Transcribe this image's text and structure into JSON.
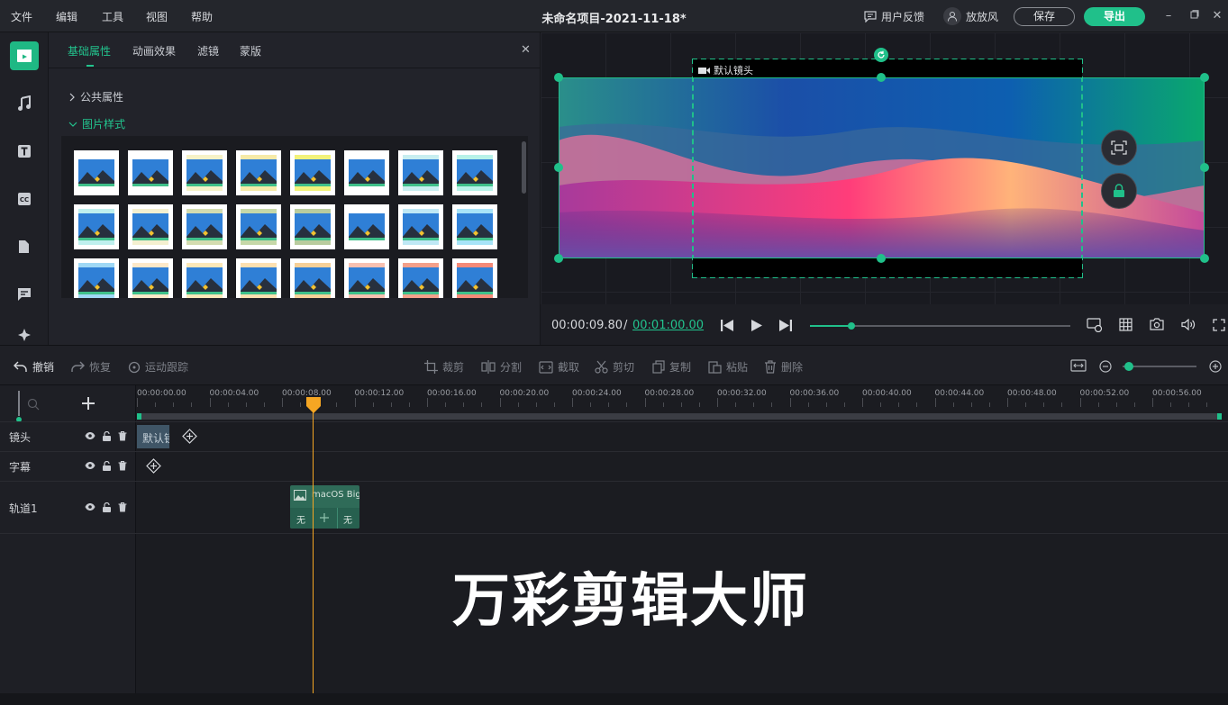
{
  "menu": [
    "文件",
    "编辑",
    "工具",
    "视图",
    "帮助"
  ],
  "title": "未命名项目-2021-11-18*",
  "topbar": {
    "feedback": "用户反馈",
    "user": "放放风",
    "save": "保存",
    "export": "导出"
  },
  "props": {
    "tabs": [
      "基础属性",
      "动画效果",
      "滤镜",
      "蒙版"
    ],
    "section_common": "公共属性",
    "section_image_style": "图片样式"
  },
  "preview": {
    "camera_label": "默认镜头",
    "time_current": "00:00:09.80",
    "time_separator": "/",
    "time_total": "00:01:00.00",
    "progress": 0.16
  },
  "toolbar": {
    "undo": "撤销",
    "redo": "恢复",
    "motion_track": "运动跟踪",
    "crop": "裁剪",
    "split": "分割",
    "capture": "截取",
    "cut": "剪切",
    "copy": "复制",
    "paste": "粘贴",
    "delete": "删除",
    "zoom": 0.08
  },
  "ruler": [
    "00:00:00.00",
    "00:00:04.00",
    "00:00:08.00",
    "00:00:12.00",
    "00:00:16.00",
    "00:00:20.00",
    "00:00:24.00",
    "00:00:28.00",
    "00:00:32.00",
    "00:00:36.00",
    "00:00:40.00",
    "00:00:44.00",
    "00:00:48.00",
    "00:00:52.00",
    "00:00:56.00"
  ],
  "tracks": {
    "camera": "镜头",
    "subtitle": "字幕",
    "track1": "轨道1",
    "camera_clip": "默认镜头",
    "media_clip": "macOS Big Sur",
    "transition_in": "无",
    "transition_out": "无"
  },
  "watermark": "万彩剪辑大师",
  "colors": {
    "accent": "#20c08a",
    "playhead": "#f5a623"
  }
}
